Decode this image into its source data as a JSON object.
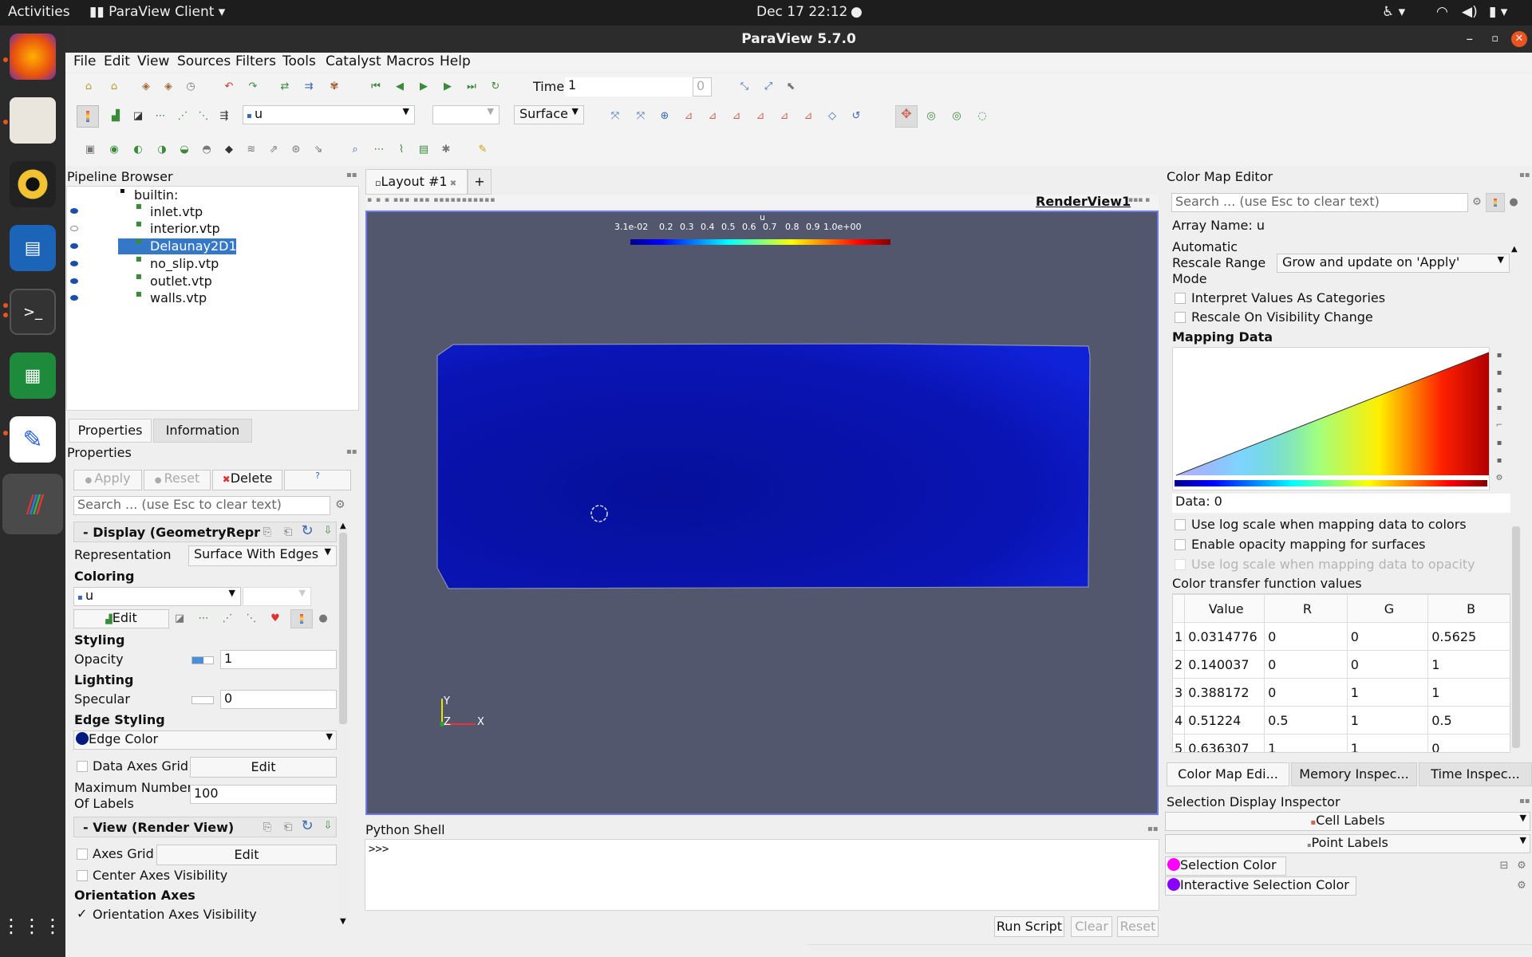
{
  "topbar": {
    "activities": "Activities",
    "app": "ParaView Client",
    "clock": "Dec 17  22:12"
  },
  "window": {
    "title": "ParaView 5.7.0"
  },
  "menu": [
    "File",
    "Edit",
    "View",
    "Sources",
    "Filters",
    "Tools",
    "Catalyst",
    "Macros",
    "Help"
  ],
  "toolbar": {
    "time_label": "Time:",
    "time_value": "1",
    "time_index": "0",
    "array": "u",
    "representation": "Surface"
  },
  "pipeline": {
    "title": "Pipeline Browser",
    "root": "builtin:",
    "items": [
      "inlet.vtp",
      "interior.vtp",
      "Delaunay2D1",
      "no_slip.vtp",
      "outlet.vtp",
      "walls.vtp"
    ]
  },
  "properties": {
    "tab_properties": "Properties",
    "tab_information": "Information",
    "title": "Properties",
    "apply": "Apply",
    "reset": "Reset",
    "delete": "Delete",
    "help": "?",
    "search_placeholder": "Search ... (use Esc to clear text)",
    "display_section": "Display (GeometryRepr",
    "representation_label": "Representation",
    "representation_value": "Surface With Edges",
    "coloring": "Coloring",
    "coloring_array": "u",
    "edit": "Edit",
    "styling": "Styling",
    "opacity_label": "Opacity",
    "opacity_value": "1",
    "lighting": "Lighting",
    "specular_label": "Specular",
    "specular_value": "0",
    "edge_styling": "Edge Styling",
    "edge_color": "Edge Color",
    "data_axes_grid": "Data Axes Grid",
    "max_labels_1": "Maximum Number",
    "max_labels_2": "Of Labels",
    "max_labels_value": "100",
    "view_section": "View (Render View)",
    "axes_grid": "Axes Grid",
    "center_axes": "Center Axes Visibility",
    "orientation_axes": "Orientation Axes",
    "orientation_axes_vis": "Orientation Axes Visibility"
  },
  "layout": {
    "tab": "Layout #1",
    "add": "+",
    "view_name": "RenderView1"
  },
  "scalarbar": {
    "title": "u",
    "ticks": [
      "3.1e-02",
      "0.2",
      "0.3",
      "0.4",
      "0.5",
      "0.6",
      "0.7",
      "0.8",
      "0.9",
      "1.0e+00"
    ]
  },
  "axes": {
    "y": "Y",
    "z": "Z",
    "x": "X"
  },
  "python": {
    "title": "Python Shell",
    "prompt": ">>>",
    "run": "Run Script",
    "clear": "Clear",
    "reset": "Reset"
  },
  "colormap": {
    "title": "Color Map Editor",
    "search_placeholder": "Search ... (use Esc to clear text)",
    "array_name": "Array Name: u",
    "auto_1": "Automatic",
    "auto_2": "Rescale Range",
    "auto_3": "Mode",
    "auto_value": "Grow and update on 'Apply'",
    "interpret": "Interpret Values As Categories",
    "rescale_vis": "Rescale On Visibility Change",
    "mapping": "Mapping Data",
    "data_label": "Data: 0",
    "log_scale": "Use log scale when mapping data to colors",
    "opacity_map": "Enable opacity mapping for surfaces",
    "log_opacity": "Use log scale when mapping data to opacity",
    "ctf_title": "Color transfer function values",
    "headers": [
      "Value",
      "R",
      "G",
      "B"
    ],
    "rows": [
      [
        "1",
        "0.0314776",
        "0",
        "0",
        "0.5625"
      ],
      [
        "2",
        "0.140037",
        "0",
        "0",
        "1"
      ],
      [
        "3",
        "0.388172",
        "0",
        "1",
        "1"
      ],
      [
        "4",
        "0.51224",
        "0.5",
        "1",
        "0.5"
      ],
      [
        "5",
        "0.636307",
        "1",
        "1",
        "0"
      ]
    ]
  },
  "bottom_tabs": [
    "Color Map Edi...",
    "Memory Inspec...",
    "Time Inspec..."
  ],
  "selection": {
    "title": "Selection Display Inspector",
    "cell_labels": "Cell Labels",
    "point_labels": "Point Labels",
    "selection_color": "Selection Color",
    "interactive_color": "Interactive Selection Color",
    "selection_hex": "#ff00ff",
    "interactive_hex": "#8a00ff"
  },
  "colors": {
    "accent": "#e95420",
    "viewport_bg": "#52576e",
    "mesh": "#0a14b4"
  }
}
